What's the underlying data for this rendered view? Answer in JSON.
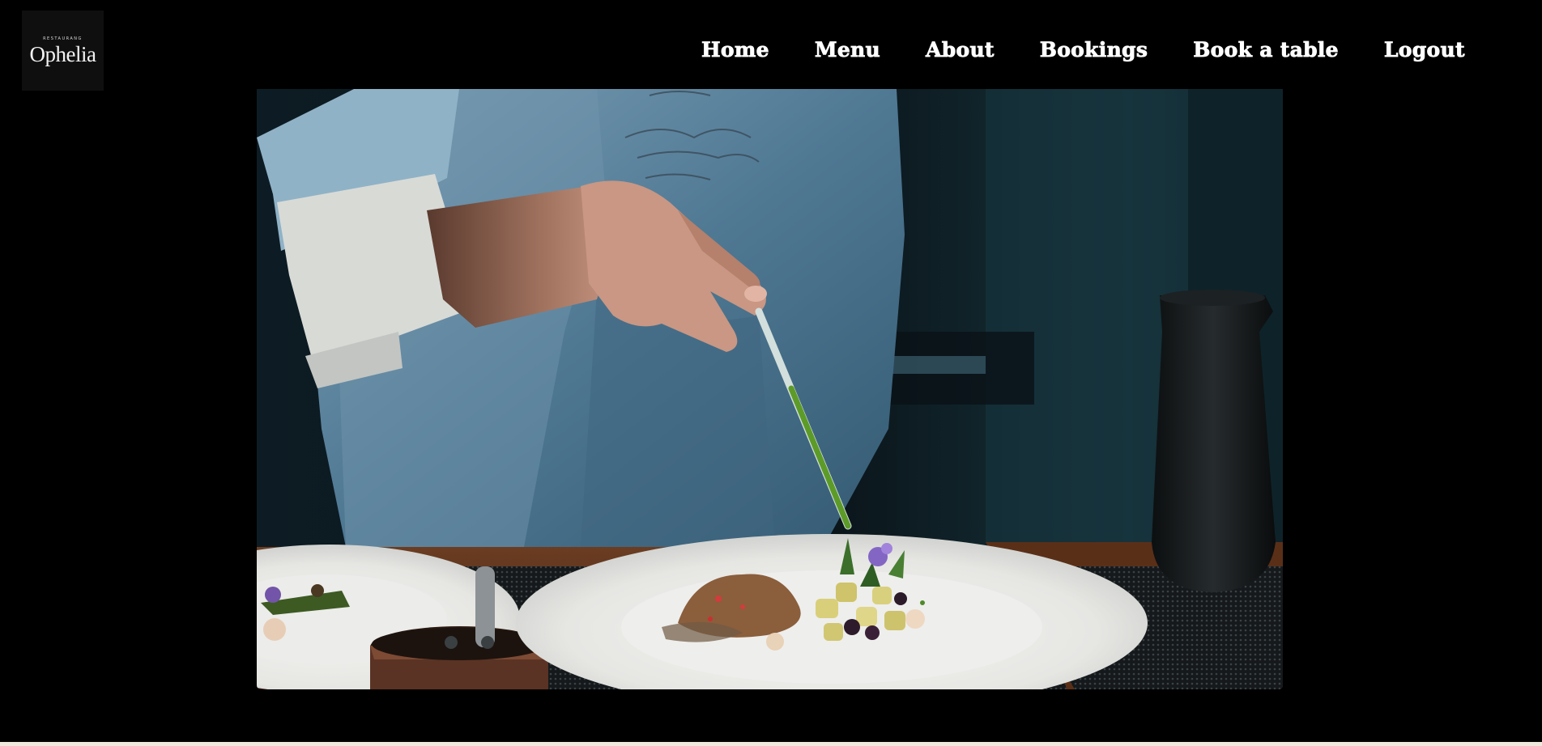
{
  "brand": {
    "small_text": "RESTAURANG",
    "name": "Ophelia"
  },
  "nav": {
    "items": [
      {
        "label": "Home"
      },
      {
        "label": "Menu"
      },
      {
        "label": "About"
      },
      {
        "label": "Bookings"
      },
      {
        "label": "Book a table"
      },
      {
        "label": "Logout"
      }
    ]
  },
  "hero": {
    "image_icon": "chef-plating-photo"
  },
  "colors": {
    "background": "#000000",
    "nav_text": "#ffffff",
    "logo_bg": "#0f0f0f"
  }
}
